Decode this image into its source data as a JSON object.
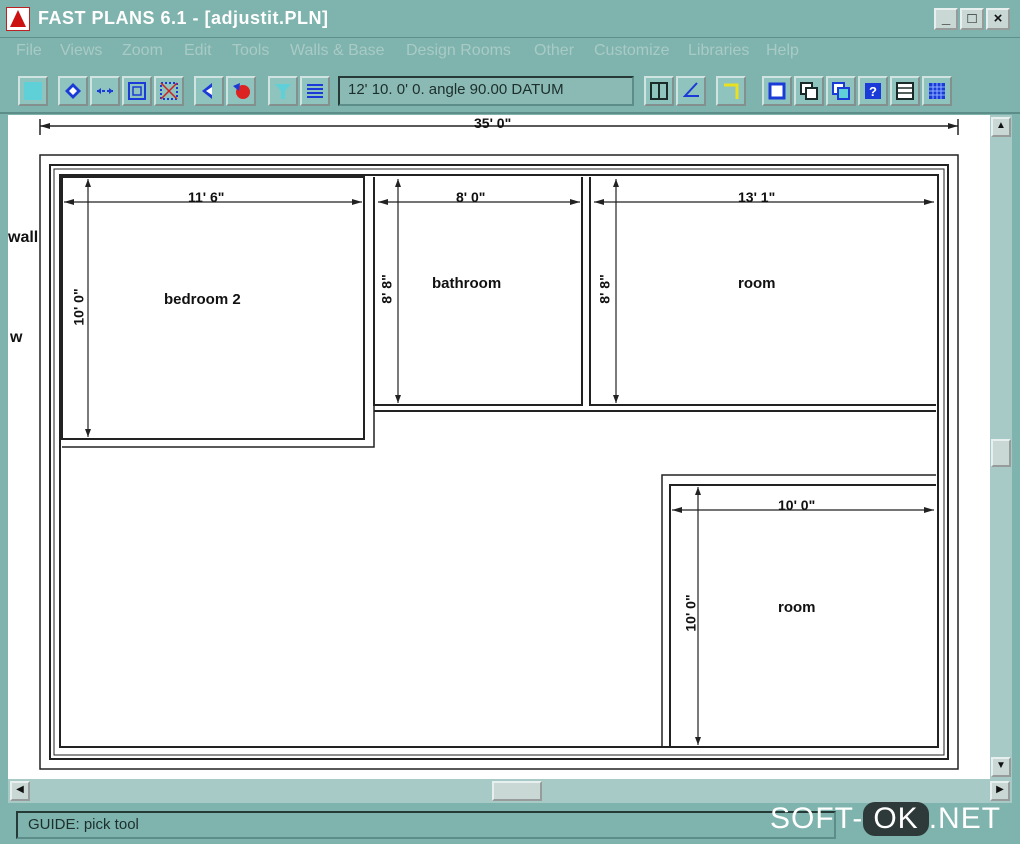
{
  "window": {
    "title": "FAST PLANS 6.1 - [adjustit.PLN]",
    "controls": [
      "_",
      "□",
      "×"
    ]
  },
  "menu": [
    "File",
    "Views",
    "Zoom",
    "Edit",
    "Tools",
    "Walls & Base",
    "Design Rooms",
    "Other",
    "Customize",
    "Libraries",
    "Help"
  ],
  "toolbar": {
    "coordinate_readout": "12' 10. 0' 0. angle 90.00 DATUM"
  },
  "plan": {
    "overall_dimension": "35' 0\"",
    "side_labels": [
      "wall",
      "w"
    ],
    "rooms": [
      {
        "name": "bedroom 2",
        "width": "11' 6\"",
        "depth": "10' 0\""
      },
      {
        "name": "bathroom",
        "width": "8' 0\"",
        "depth": "8' 8\""
      },
      {
        "name": "room",
        "width": "13' 1\"",
        "depth": "8' 8\""
      },
      {
        "name": "room",
        "width": "10' 0\"",
        "depth": "10' 0\""
      }
    ]
  },
  "status": {
    "guide": "GUIDE: pick tool"
  },
  "watermark": {
    "left": "SOFT-",
    "mid": "OK",
    "right": ".NET"
  },
  "colors": {
    "chrome": "#7fb3ad",
    "canvas": "#ffffff",
    "wall_line": "#222222",
    "icon_blue": "#1a3bd8"
  }
}
